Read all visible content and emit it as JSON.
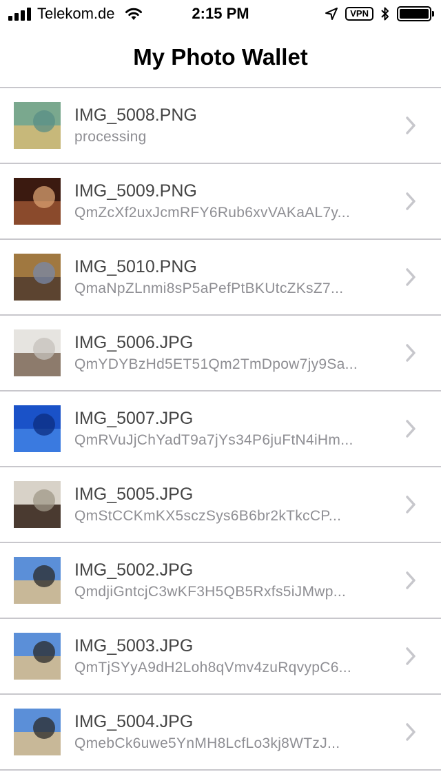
{
  "status_bar": {
    "carrier": "Telekom.de",
    "time": "2:15 PM",
    "vpn": "VPN",
    "icons": [
      "signal-icon",
      "wifi-icon",
      "location-icon",
      "bluetooth-icon",
      "battery-icon"
    ],
    "battery_level": 1.0
  },
  "nav": {
    "title": "My Photo Wallet"
  },
  "photos": [
    {
      "name": "IMG_5008.PNG",
      "subtitle": "processing",
      "thumb": [
        "#7aa88e",
        "#c7b87a",
        "#5a8f86"
      ]
    },
    {
      "name": "IMG_5009.PNG",
      "subtitle": "QmZcXf2uxJcmRFY6Rub6xvVAKaAL7y...",
      "thumb": [
        "#3b1a10",
        "#8a4a2c",
        "#d8a070"
      ]
    },
    {
      "name": "IMG_5010.PNG",
      "subtitle": "QmaNpZLnmi8sP5aPefPtBKUtcZKsZ7...",
      "thumb": [
        "#a07840",
        "#5c4430",
        "#7888a8"
      ]
    },
    {
      "name": "IMG_5006.JPG",
      "subtitle": "QmYDYBzHd5ET51Qm2TmDpow7jy9Sa...",
      "thumb": [
        "#e6e4e0",
        "#8d7b6c",
        "#c6c2bc"
      ]
    },
    {
      "name": "IMG_5007.JPG",
      "subtitle": "QmRVuJjChYadT9a7jYs34P6juFtN4iHm...",
      "thumb": [
        "#1a52c8",
        "#3a7ae0",
        "#0c2e80"
      ]
    },
    {
      "name": "IMG_5005.JPG",
      "subtitle": "QmStCCKmKX5sczSys6B6br2kTkcCP...",
      "thumb": [
        "#d8d2c8",
        "#4a3a30",
        "#a09888"
      ]
    },
    {
      "name": "IMG_5002.JPG",
      "subtitle": "QmdjiGntcjC3wKF3H5QB5Rxfs5iJMwp...",
      "thumb": [
        "#5b8fd8",
        "#c8b898",
        "#2a2a2a"
      ]
    },
    {
      "name": "IMG_5003.JPG",
      "subtitle": "QmTjSYyA9dH2Loh8qVmv4zuRqvypC6...",
      "thumb": [
        "#5b8fd8",
        "#c8b898",
        "#2a2a2a"
      ]
    },
    {
      "name": "IMG_5004.JPG",
      "subtitle": "QmebCk6uwe5YnMH8LcfLo3kj8WTzJ...",
      "thumb": [
        "#5b8fd8",
        "#c8b898",
        "#2a2a2a"
      ]
    }
  ],
  "colors": {
    "separator": "#c8c7cc",
    "title_text": "#444444",
    "subtitle_text": "#8e8e93",
    "chevron": "#c7c7cc"
  }
}
